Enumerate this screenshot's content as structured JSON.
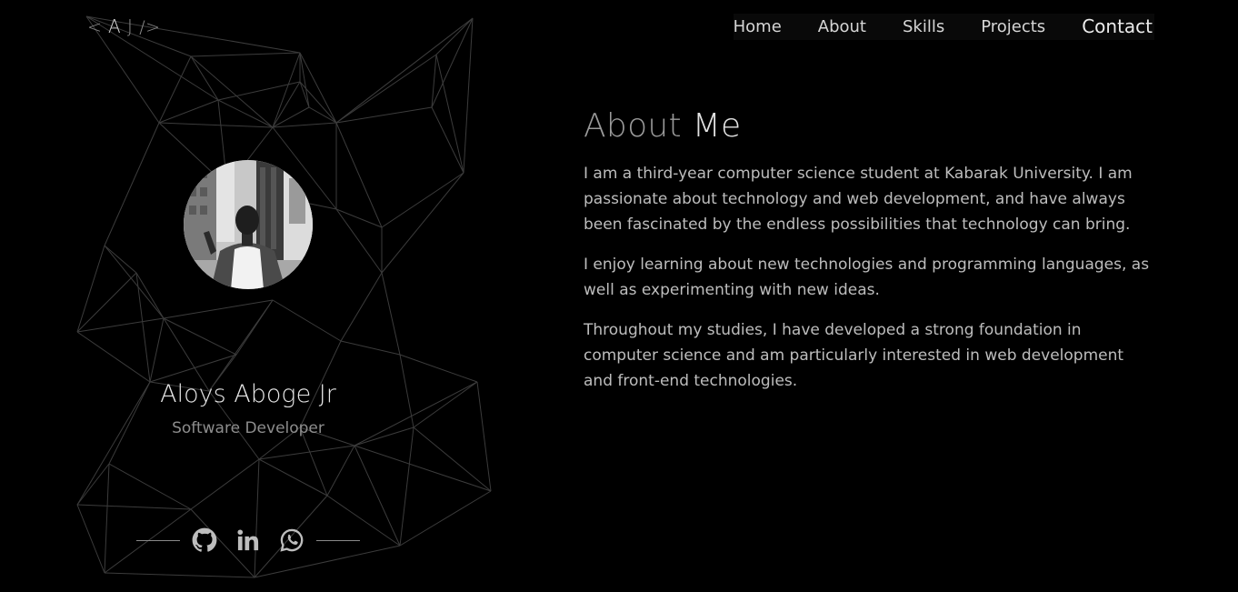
{
  "brand": {
    "logo_open": "< ",
    "logo_a": "A",
    "logo_j": " J ",
    "logo_close": "/>"
  },
  "nav": {
    "items": [
      {
        "label": "Home"
      },
      {
        "label": "About"
      },
      {
        "label": "Skills"
      },
      {
        "label": "Projects"
      },
      {
        "label": "Contact"
      }
    ]
  },
  "profile": {
    "name": "Aloys Aboge Jr",
    "role": "Software Developer",
    "socials": [
      {
        "icon": "github-icon"
      },
      {
        "icon": "linkedin-icon"
      },
      {
        "icon": "whatsapp-icon"
      }
    ]
  },
  "about": {
    "title_part1": "About ",
    "title_part2": "Me",
    "paragraphs": [
      "I am a third-year computer science student at Kabarak University. I am passionate about technology and web development, and have always been fascinated by the endless possibilities that technology can bring.",
      "I enjoy learning about new technologies and programming languages, as well as experimenting with new ideas.",
      "Throughout my studies, I have developed a strong foundation in computer science and am particularly interested in web development and front-end technologies."
    ]
  },
  "colors": {
    "background": "#000000",
    "text": "#bdbdbd",
    "accent": "#e6e6e6",
    "network_lines": "#3a3a3a"
  }
}
